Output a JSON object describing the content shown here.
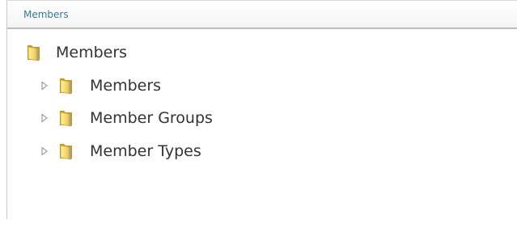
{
  "panel": {
    "title": "Members"
  },
  "tree": {
    "root": {
      "label": "Members",
      "icon": "folder-icon"
    },
    "children": [
      {
        "label": "Members",
        "icon": "folder-icon",
        "expander": "expand-arrow-icon"
      },
      {
        "label": "Member Groups",
        "icon": "folder-icon",
        "expander": "expand-arrow-icon"
      },
      {
        "label": "Member Types",
        "icon": "folder-icon",
        "expander": "expand-arrow-icon"
      }
    ]
  },
  "colors": {
    "title": "#3b7a8e",
    "text": "#333333",
    "folder_light": "#f7e38a",
    "folder_dark": "#d9b22c",
    "header_border": "#bdbdbd"
  }
}
